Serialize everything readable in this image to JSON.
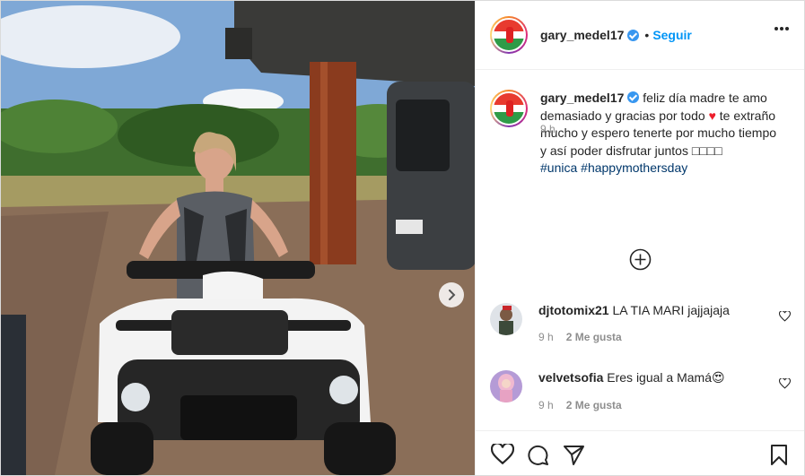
{
  "post": {
    "username": "gary_medel17",
    "follow_label": "Seguir",
    "dot": "•",
    "caption": {
      "text": "feliz día madre te amo demasiado y gracias por todo",
      "heart": "♥",
      "text2": "te extraño mucho y espero tenerte por mucho tiempo y así poder disfrutar juntos □□□□",
      "hashtags": [
        "#unica",
        "#happymothersday"
      ],
      "time": "9 h"
    }
  },
  "comments": [
    {
      "username": "djtotomix21",
      "text": "LA TIA MARI jajjajaja",
      "time": "9 h",
      "likes": "2 Me gusta"
    },
    {
      "username": "velvetsofia",
      "text": "Eres igual a Mamá",
      "emoji": "😍",
      "time": "9 h",
      "likes": "2 Me gusta"
    }
  ],
  "icons": {
    "more": "more-options-icon",
    "verified": "verified-badge-icon",
    "next": "chevron-right-icon",
    "add": "plus-circle-icon",
    "like": "heart-icon",
    "comment": "comment-icon",
    "share": "paper-plane-icon",
    "save": "bookmark-icon"
  },
  "colors": {
    "accent": "#0095f6",
    "verified": "#3897f0",
    "muted": "#8e8e8e",
    "hashtag": "#00376b",
    "heart": "#ed1e2b"
  }
}
